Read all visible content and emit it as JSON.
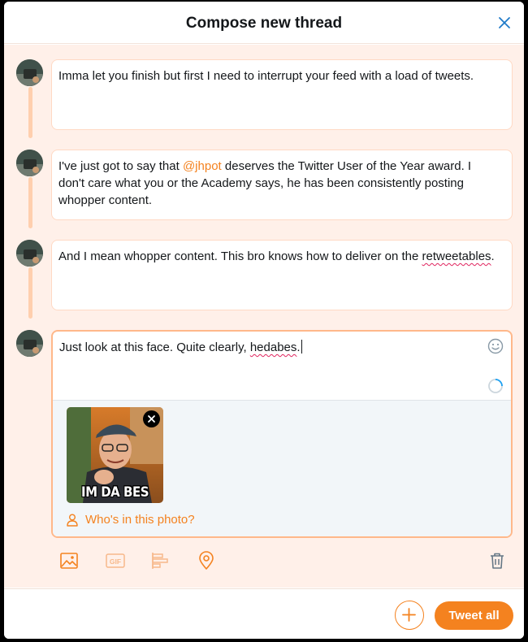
{
  "header": {
    "title": "Compose new thread",
    "close_icon": "close-icon"
  },
  "thread": {
    "tweets": [
      {
        "pre": "Imma let you finish but first I need to interrupt your feed with a load of tweets."
      },
      {
        "pre": "I've just got to say that ",
        "mention": "@jhpot",
        "post": " deserves the Twitter User of the Year award. I don't care what you or the Academy says, he has been consistently posting whopper content."
      },
      {
        "pre": "And I mean whopper content. This bro knows how to deliver on the ",
        "misspelled": "retweetables",
        "post": "."
      },
      {
        "pre": "Just look at this face. Quite clearly, ",
        "misspelled": "hedabes",
        "post": "."
      }
    ],
    "active_tweet": {
      "emoji_icon": "smiley-icon",
      "photo": {
        "caption": "IM DA BES",
        "remove_icon": "close-icon"
      },
      "tag_people": {
        "icon": "person-icon",
        "label": "Who's in this photo?"
      }
    }
  },
  "toolbar": {
    "icons": [
      "image-icon",
      "gif-icon",
      "poll-icon",
      "location-icon",
      "trash-icon"
    ],
    "gif_label": "GIF"
  },
  "footer": {
    "add_icon": "plus-icon",
    "tweet_all_label": "Tweet all"
  },
  "colors": {
    "accent": "#f4821f",
    "thread_bg": "#fff0e9",
    "thread_line": "#ffcfae",
    "text": "#14171a"
  }
}
